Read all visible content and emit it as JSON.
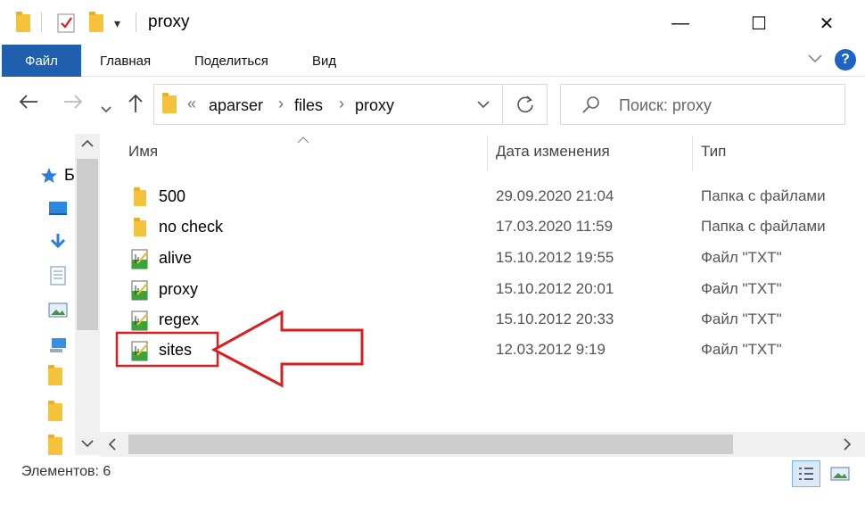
{
  "window": {
    "title": "proxy",
    "minimize_glyph": "—",
    "maximize_glyph": "☐",
    "close_glyph": "✕"
  },
  "ribbon": {
    "tabs": [
      "Файл",
      "Главная",
      "Поделиться",
      "Вид"
    ],
    "help_glyph": "?"
  },
  "address": {
    "overflow": "«",
    "crumbs": [
      "aparser",
      "files",
      "proxy"
    ]
  },
  "search": {
    "placeholder": "Поиск: proxy"
  },
  "columns": {
    "name": "Имя",
    "date": "Дата изменения",
    "type": "Тип"
  },
  "files": [
    {
      "name": "500",
      "date": "29.09.2020 21:04",
      "type": "Папка с файлами",
      "icon": "folder-icon"
    },
    {
      "name": "no check",
      "date": "17.03.2020 11:59",
      "type": "Папка с файлами",
      "icon": "folder-icon"
    },
    {
      "name": "alive",
      "date": "15.10.2012 19:55",
      "type": "Файл \"TXT\"",
      "icon": "txt-file-icon"
    },
    {
      "name": "proxy",
      "date": "15.10.2012 20:01",
      "type": "Файл \"TXT\"",
      "icon": "txt-file-icon"
    },
    {
      "name": "regex",
      "date": "15.10.2012 20:33",
      "type": "Файл \"TXT\"",
      "icon": "txt-file-icon"
    },
    {
      "name": "sites",
      "date": "12.03.2012 9:19",
      "type": "Файл \"TXT\"",
      "icon": "txt-file-icon"
    }
  ],
  "leftpane": {
    "quick_access_partial": "Б"
  },
  "status": {
    "items_count": "Элементов: 6"
  },
  "colors": {
    "file_tab": "#1f5fae",
    "annotation": "#d62020",
    "folder": "#f5c33b"
  }
}
